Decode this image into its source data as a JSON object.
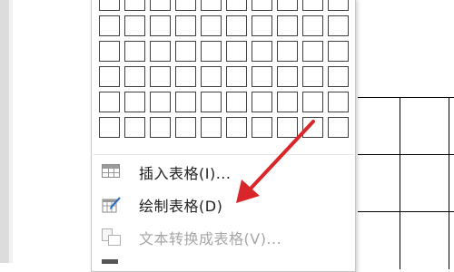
{
  "table_menu": {
    "grid": {
      "columns": 10,
      "rows": 6
    },
    "items": [
      {
        "label": "插入表格(I)...",
        "icon": "insert-table-icon",
        "enabled": true
      },
      {
        "label": "绘制表格(D)",
        "icon": "draw-table-icon",
        "enabled": true
      },
      {
        "label": "文本转换成表格(V)...",
        "icon": "convert-text-to-table-icon",
        "enabled": false
      }
    ]
  },
  "colors": {
    "arrow": "#d9262b",
    "menu_border": "#c6c6c6",
    "disabled_text": "#a6a6a6",
    "draw_icon_accent": "#2f6fbd"
  }
}
